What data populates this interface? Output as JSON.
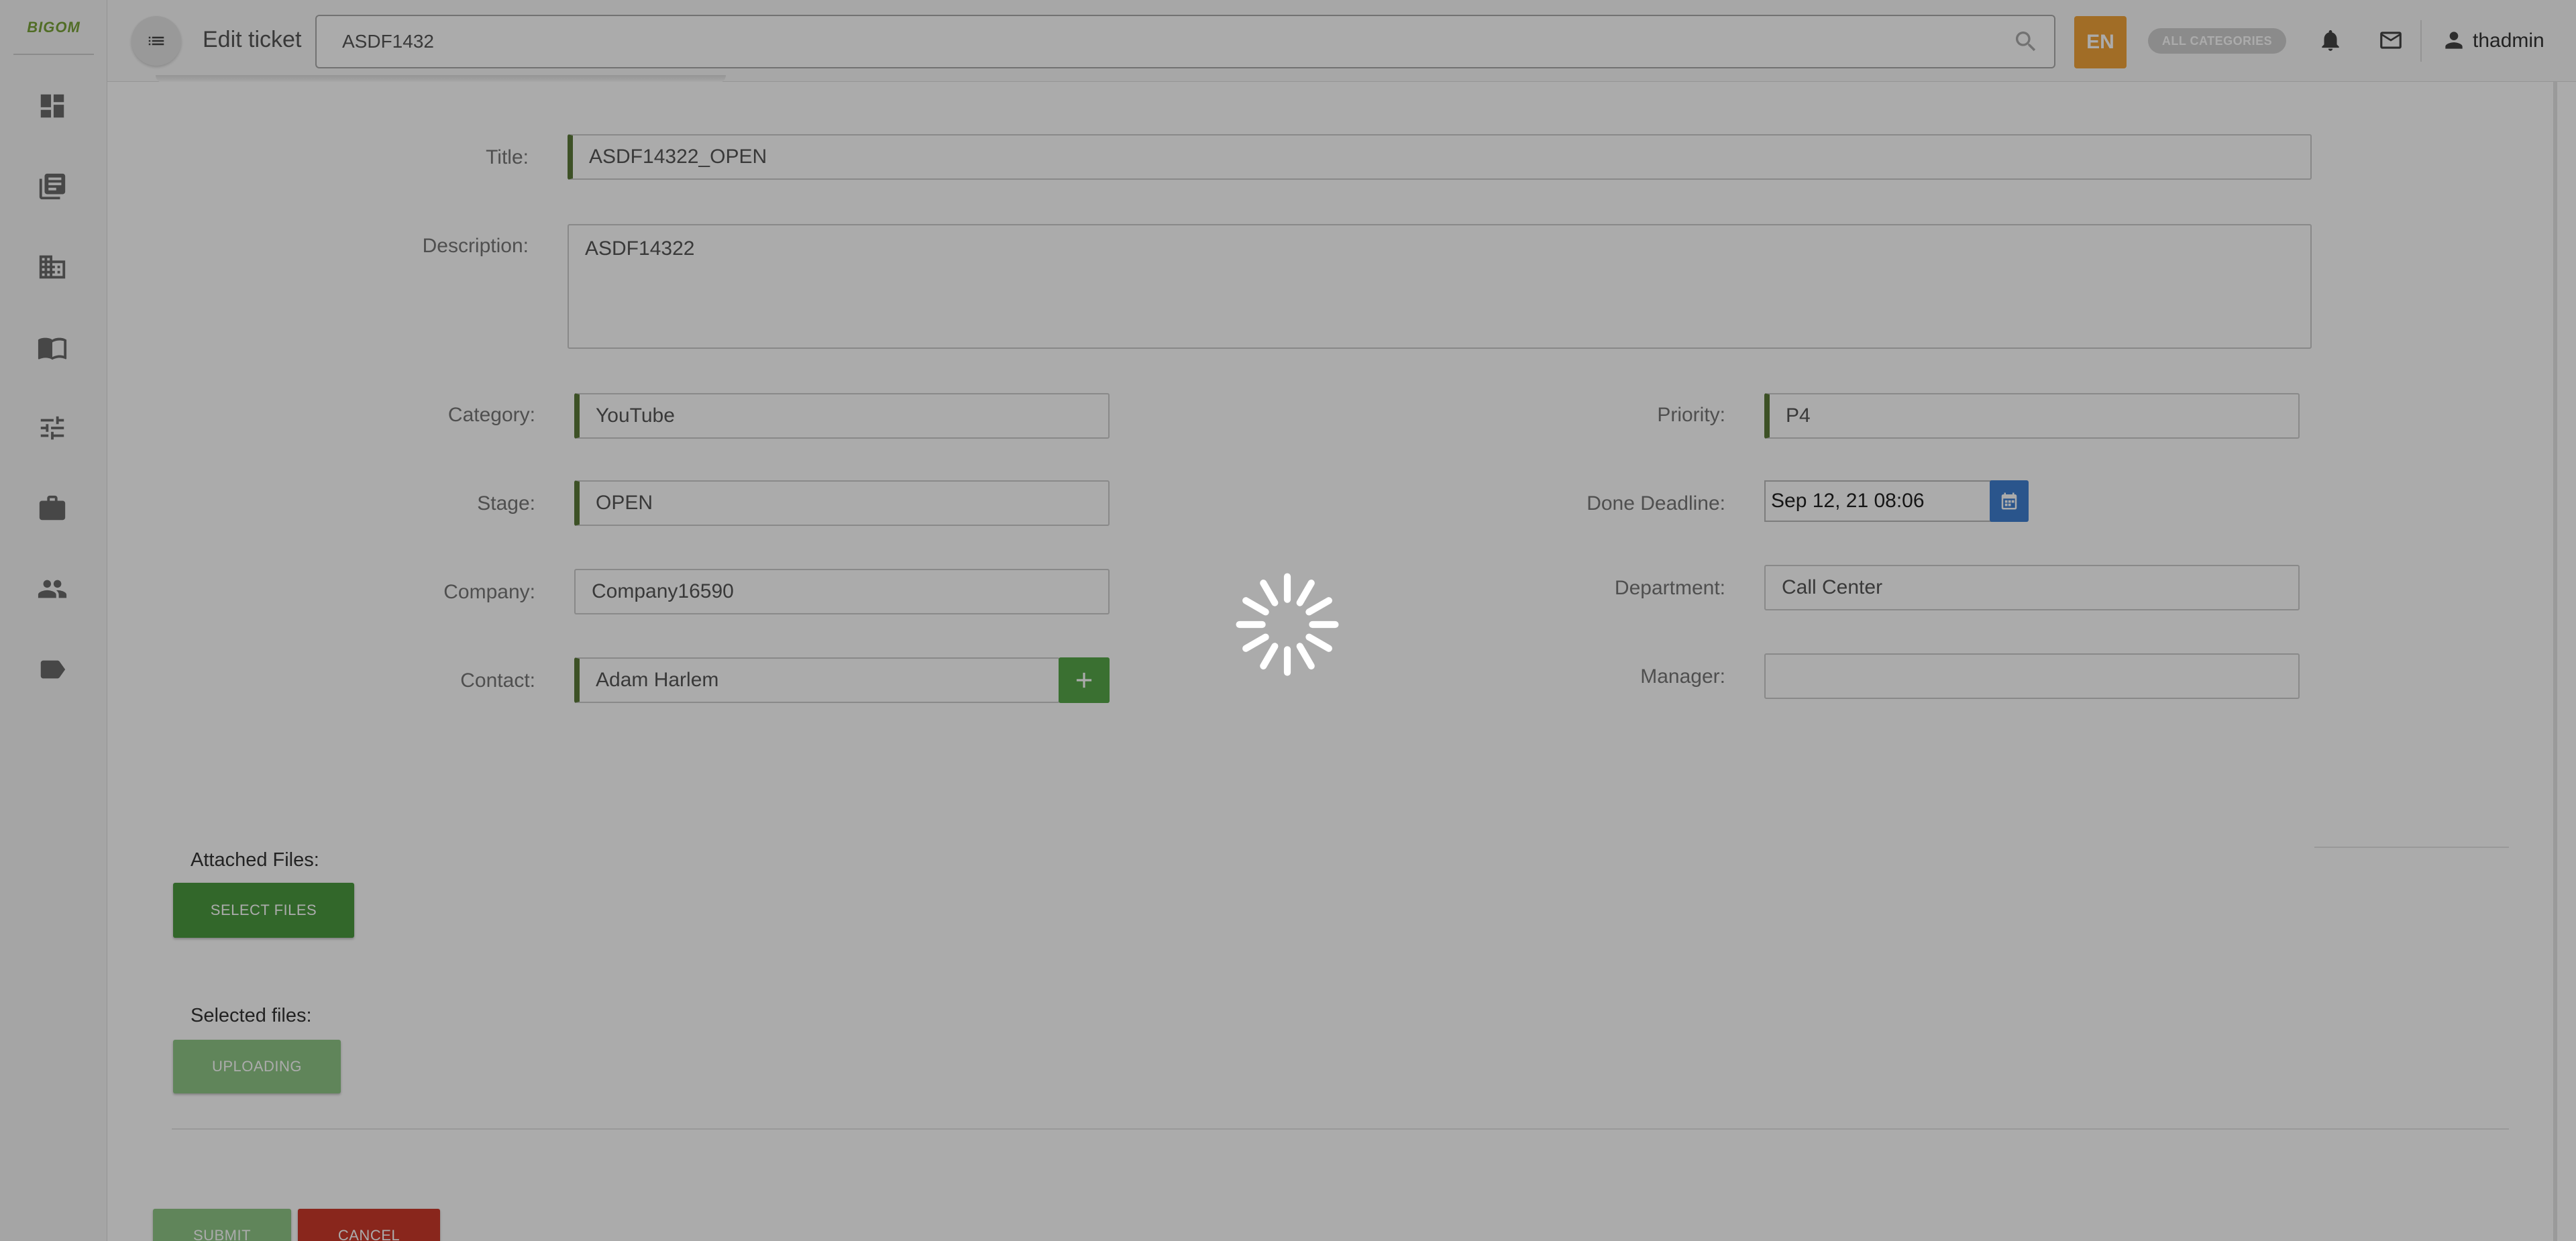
{
  "app": {
    "logo_text": "BIGOM"
  },
  "sidebar": {
    "items": [
      {
        "icon": "dashboard-icon"
      },
      {
        "icon": "tickets-icon"
      },
      {
        "icon": "companies-icon"
      },
      {
        "icon": "knowledge-base-icon"
      },
      {
        "icon": "settings-sliders-icon"
      },
      {
        "icon": "briefcase-icon"
      },
      {
        "icon": "people-icon"
      },
      {
        "icon": "tag-icon"
      }
    ]
  },
  "header": {
    "title": "Edit ticket",
    "search_value": "ASDF1432",
    "language": "EN",
    "categories_label": "ALL CATEGORIES",
    "user": "thadmin"
  },
  "form": {
    "title_label": "Title:",
    "title_value": "ASDF14322_OPEN",
    "description_label": "Description:",
    "description_value": "ASDF14322",
    "category_label": "Category:",
    "category_value": "YouTube",
    "stage_label": "Stage:",
    "stage_value": "OPEN",
    "company_label": "Company:",
    "company_value": "Company16590",
    "contact_label": "Contact:",
    "contact_value": "Adam Harlem",
    "priority_label": "Priority:",
    "priority_value": "P4",
    "deadline_label": "Done Deadline:",
    "deadline_value": "Sep 12, 21 08:06",
    "department_label": "Department:",
    "department_value": "Call Center",
    "manager_label": "Manager:",
    "manager_value": ""
  },
  "files": {
    "attached_label": "Attached Files:",
    "select_button": "SELECT FILES",
    "selected_label": "Selected files:",
    "uploading_button": "UPLOADING"
  },
  "actions": {
    "submit": "SUBMIT",
    "cancel": "CANCEL"
  },
  "colors": {
    "accent_green": "#4b9a3f",
    "field_marker": "#5b7a3a",
    "language_button": "#f0a33a",
    "cancel_red": "#cc3a2a",
    "calendar_blue": "#3f7fd1"
  },
  "state": {
    "loading": true
  }
}
